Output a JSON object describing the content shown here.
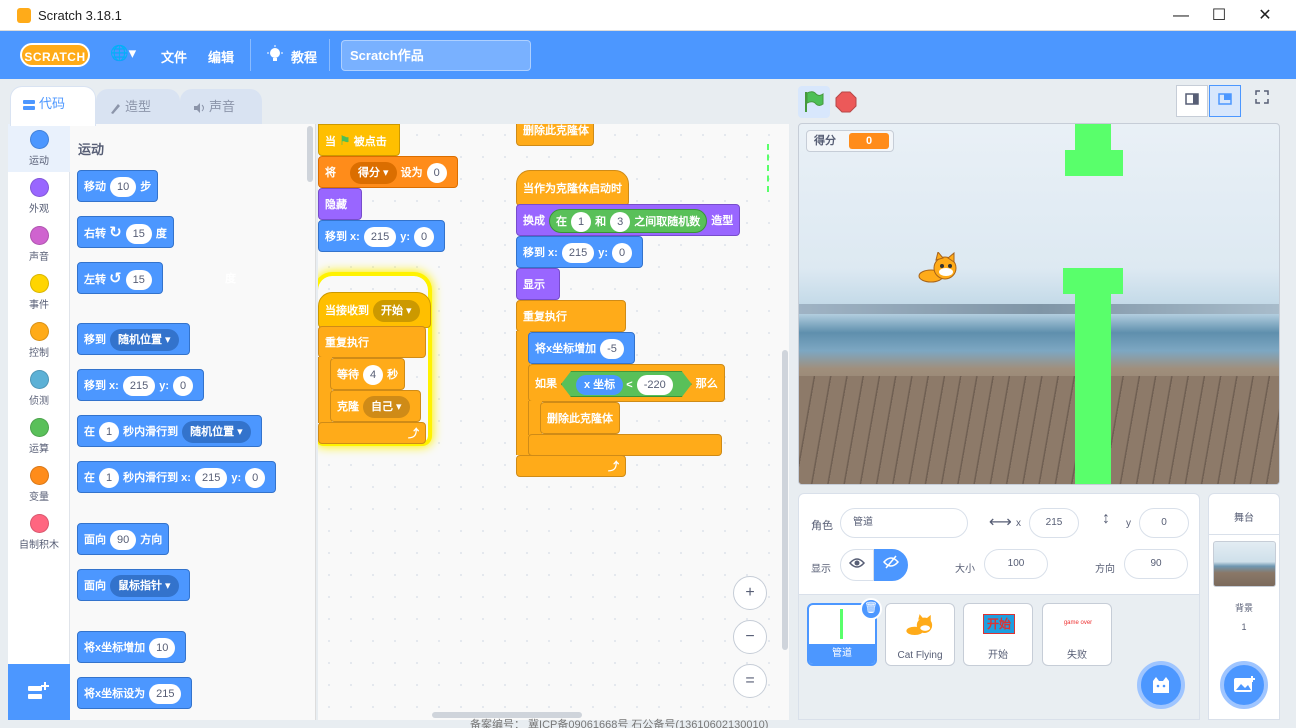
{
  "window": {
    "title": "Scratch 3.18.1",
    "minimize": "—",
    "maximize": "☐",
    "close": "✕"
  },
  "menu": {
    "logo": "SCRATCH",
    "globe": "🌐▾",
    "file": "文件",
    "edit": "编辑",
    "tutorials": "教程",
    "project_name": "Scratch作品"
  },
  "tabs": {
    "code": "代码",
    "costumes": "造型",
    "sounds": "声音"
  },
  "categories": [
    {
      "label": "运动",
      "color": "#4c97ff"
    },
    {
      "label": "外观",
      "color": "#9966ff"
    },
    {
      "label": "声音",
      "color": "#cf63cf"
    },
    {
      "label": "事件",
      "color": "#ffd500"
    },
    {
      "label": "控制",
      "color": "#ffab19"
    },
    {
      "label": "侦测",
      "color": "#5cb1d6"
    },
    {
      "label": "运算",
      "color": "#59c059"
    },
    {
      "label": "变量",
      "color": "#ff8c1a"
    },
    {
      "label": "自制积木",
      "color": "#ff6680"
    }
  ],
  "palette": {
    "heading": "运动",
    "move": {
      "pre": "移动",
      "val": "10",
      "post": "步"
    },
    "turn_right": {
      "pre": "右转",
      "icon": "↻",
      "val": "15",
      "post": "度"
    },
    "turn_left": {
      "pre": "左转",
      "icon": "↺",
      "val": "15",
      "post": "度"
    },
    "goto": {
      "pre": "移到",
      "dd": "随机位置"
    },
    "goto_xy": {
      "pre": "移到 x:",
      "x": "215",
      "ymid": "y:",
      "y": "0"
    },
    "glide": {
      "pre": "在",
      "val": "1",
      "mid": "秒内滑行到",
      "dd": "随机位置"
    },
    "glide_xy": {
      "pre": "在",
      "val": "1",
      "mid": "秒内滑行到 x:",
      "x": "215",
      "ymid": "y:",
      "y": "0"
    },
    "point": {
      "pre": "面向",
      "val": "90",
      "post": "方向"
    },
    "point_towards": {
      "pre": "面向",
      "dd": "鼠标指针"
    },
    "change_x": {
      "pre": "将x坐标增加",
      "val": "10"
    },
    "set_x": {
      "pre": "将x坐标设为",
      "val": "215"
    }
  },
  "script1": {
    "hat": {
      "pre": "当",
      "flag": "⚑",
      "post": "被点击"
    },
    "setvar": {
      "pre": "将",
      "dd": "得分",
      "mid": "设为",
      "val": "0"
    },
    "hide": "隐藏",
    "goto": {
      "pre": "移到 x:",
      "x": "215",
      "ymid": "y:",
      "y": "0"
    }
  },
  "script2": {
    "hat": {
      "pre": "当接收到",
      "dd": "开始"
    },
    "forever": "重复执行",
    "wait": {
      "pre": "等待",
      "val": "4",
      "post": "秒"
    },
    "clone": {
      "pre": "克隆",
      "dd": "自己"
    },
    "arrow": "⤴"
  },
  "script3": {
    "top": "删除此克隆体",
    "hat": "当作为克隆体启动时",
    "switch": {
      "pre": "换成",
      "rin": "在",
      "a": "1",
      "and": "和",
      "b": "3",
      "rpost": "之间取随机数",
      "post": "造型"
    },
    "goto": {
      "pre": "移到 x:",
      "x": "215",
      "ymid": "y:",
      "y": "0"
    },
    "show": "显示",
    "forever": "重复执行",
    "change_x": {
      "pre": "将x坐标增加",
      "val": "-5"
    },
    "if": {
      "pre": "如果",
      "rep": "x 坐标",
      "op": "<",
      "val": "-220",
      "post": "那么"
    },
    "delete": "删除此克隆体",
    "arrow": "⤴"
  },
  "zoom": {
    "in": "+",
    "out": "−",
    "reset": "="
  },
  "stage": {
    "monitor_label": "得分",
    "monitor_value": "0"
  },
  "sprite_info": {
    "sprite_label": "角色",
    "sprite_name": "管道",
    "x_label": "x",
    "x": "215",
    "y_label": "y",
    "y": "0",
    "show_label": "显示",
    "size_label": "大小",
    "size": "100",
    "direction_label": "方向",
    "direction": "90"
  },
  "sprites": [
    {
      "name": "管道",
      "selected": true
    },
    {
      "name": "Cat Flying"
    },
    {
      "name": "开始",
      "thumb": "开始"
    },
    {
      "name": "失败",
      "thumb": "game over"
    }
  ],
  "stage_panel": {
    "heading": "舞台",
    "backdrop_label": "背景",
    "backdrop_count": "1"
  },
  "footer": "备案编号：  冀ICP备09061668号 石公备号(13610602130010)"
}
